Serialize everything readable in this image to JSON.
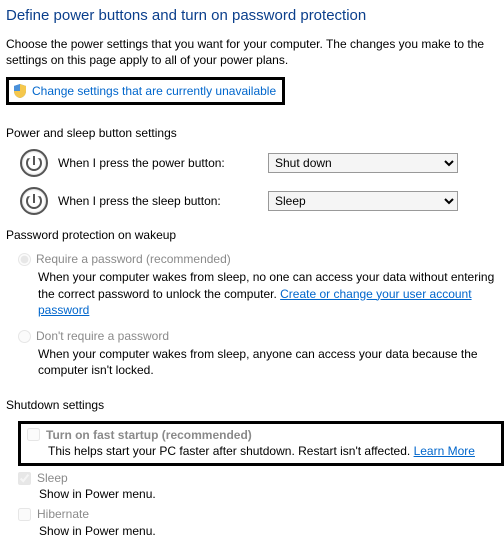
{
  "header": {
    "title": "Define power buttons and turn on password protection",
    "intro": "Choose the power settings that you want for your computer. The changes you make to the settings on this page apply to all of your power plans.",
    "change_link": "Change settings that are currently unavailable"
  },
  "power_sleep": {
    "heading": "Power and sleep button settings",
    "power_label": "When I press the power button:",
    "power_value": "Shut down",
    "sleep_label": "When I press the sleep button:",
    "sleep_value": "Sleep"
  },
  "pw": {
    "heading": "Password protection on wakeup",
    "req_label": "Require a password (recommended)",
    "req_desc_a": "When your computer wakes from sleep, no one can access your data without entering the correct password to unlock the computer. ",
    "req_link": "Create or change your user account password",
    "noreq_label": "Don't require a password",
    "noreq_desc": "When your computer wakes from sleep, anyone can access your data because the computer isn't locked."
  },
  "shutdown": {
    "heading": "Shutdown settings",
    "fast_label": "Turn on fast startup (recommended)",
    "fast_desc": "This helps start your PC faster after shutdown. Restart isn't affected. ",
    "learn_more": "Learn More",
    "sleep_label": "Sleep",
    "sleep_desc": "Show in Power menu.",
    "hib_label": "Hibernate",
    "hib_desc": "Show in Power menu."
  }
}
